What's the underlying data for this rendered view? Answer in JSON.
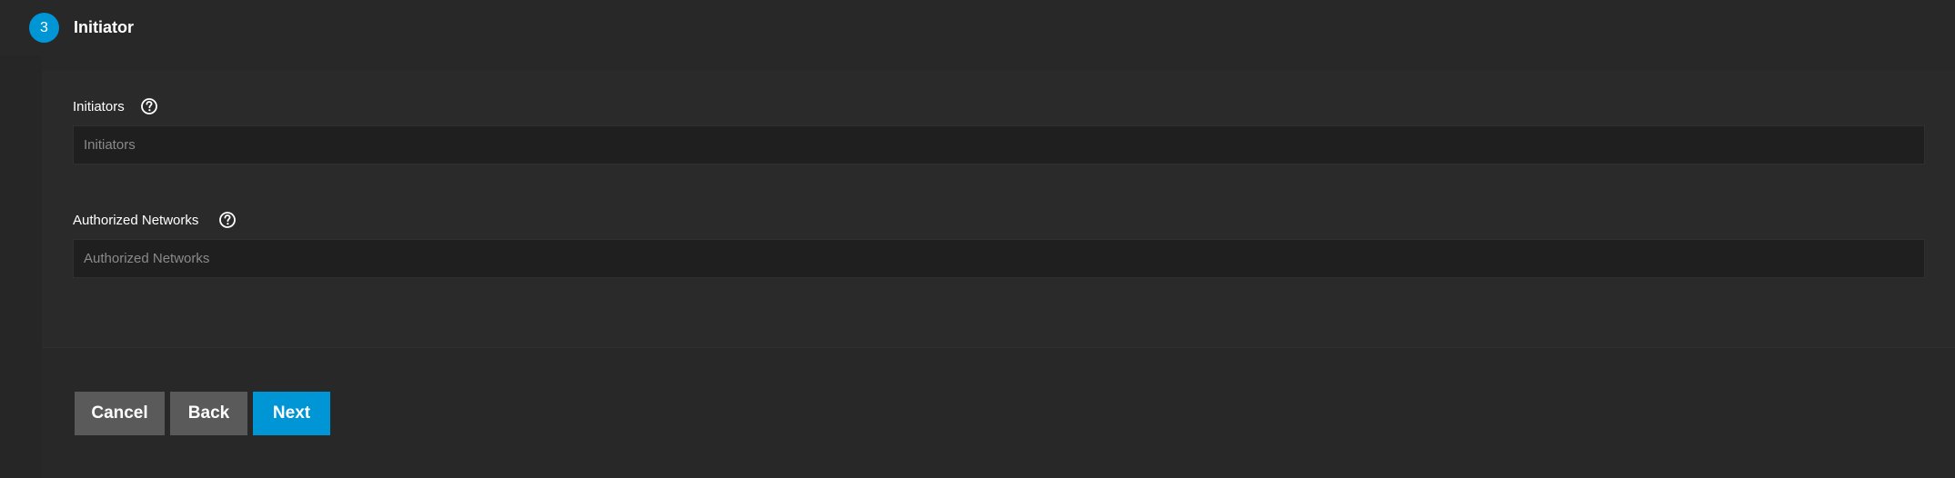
{
  "step": {
    "number": "3",
    "title": "Initiator"
  },
  "fields": {
    "initiators": {
      "label": "Initiators",
      "placeholder": "Initiators",
      "value": "",
      "help_icon": "help-circle-icon"
    },
    "authorized_networks": {
      "label": "Authorized Networks",
      "placeholder": "Authorized Networks",
      "value": "",
      "help_icon": "help-circle-icon"
    }
  },
  "actions": {
    "cancel_label": "Cancel",
    "back_label": "Back",
    "next_label": "Next"
  },
  "colors": {
    "accent": "#0095d5",
    "background": "#282828",
    "input_background": "#1f1f1f",
    "secondary_button": "#5a5a5a"
  }
}
